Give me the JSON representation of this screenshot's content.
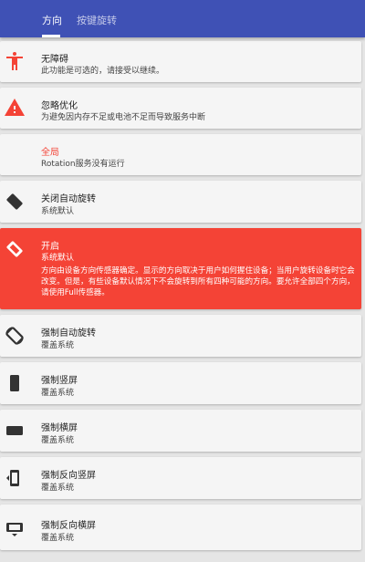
{
  "tabs": [
    {
      "label": "方向"
    },
    {
      "label": "按键旋转"
    }
  ],
  "colors": {
    "appbar": "#3f51b5",
    "accent": "#f44336",
    "card": "#f5f5f5",
    "background": "#e5e5e5"
  },
  "items": [
    {
      "icon": "accessibility-icon",
      "title": "无障碍",
      "subtitle": "此功能是可选的，请接受以继续。"
    },
    {
      "icon": "warning-icon",
      "title": "忽略优化",
      "subtitle": "为避免因内存不足或电池不足而导致服务中断"
    },
    {
      "icon": "",
      "title": "全局",
      "subtitle": "Rotation服务没有运行"
    },
    {
      "icon": "rotate-lock-icon",
      "title": "关闭自动旋转",
      "subtitle": "系统默认"
    },
    {
      "icon": "sensor-rotation-icon",
      "title": "开启",
      "subtitle": "系统默认",
      "description": "方向由设备方向传感器确定。显示的方向取决于用户如何握住设备；当用户旋转设备时它会改变。但是，有些设备默认情况下不会旋转到所有四种可能的方向。要允许全部四个方向，请使用Full传感器。"
    },
    {
      "icon": "auto-rotate-icon",
      "title": "强制自动旋转",
      "subtitle": "覆盖系统"
    },
    {
      "icon": "portrait-icon",
      "title": "强制竖屏",
      "subtitle": "覆盖系统"
    },
    {
      "icon": "landscape-icon",
      "title": "强制横屏",
      "subtitle": "覆盖系统"
    },
    {
      "icon": "reverse-portrait-icon",
      "title": "强制反向竖屏",
      "subtitle": "覆盖系统"
    },
    {
      "icon": "reverse-landscape-icon",
      "title": "强制反向横屏",
      "subtitle": "覆盖系统"
    }
  ]
}
